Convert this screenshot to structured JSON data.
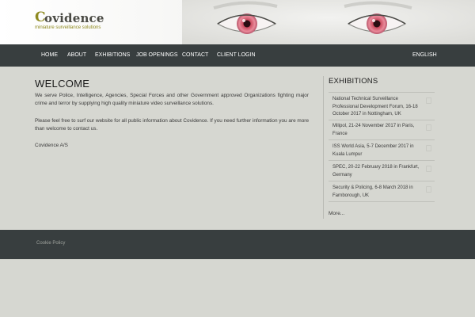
{
  "header": {
    "logo_initial": "C",
    "logo_rest": "ovidence",
    "tagline": "miniature surveillance solutions"
  },
  "nav": {
    "home": "HOME",
    "about": "ABOUT",
    "exhibitions": "EXHIBITIONS",
    "job_openings": "JOB OPENINGS",
    "contact": "CONTACT",
    "client_login": "CLIENT LOGIN",
    "language": "ENGLISH"
  },
  "main": {
    "title": "WELCOME",
    "paragraph1": "We serve Police, Intelligence, Agencies, Special Forces and other Government approved Organizations fighting major crime and terror by supplying high quality miniature video surveillance solutions.",
    "paragraph2": "Please feel free to surf our website for all public information about Covidence. If you need further information you are more than welcome to contact us.",
    "signature": "Covidence A/S"
  },
  "sidebar": {
    "title": "EXHIBITIONS",
    "items": [
      "National Technical Surveillance Professional Development Forum, 16-18 October 2017 in Nottingham, UK",
      "Milipol, 21-24 November 2017 in Paris, France",
      "ISS World Asia, 5-7 December 2017 in Kuala Lumpur",
      "SPEC, 20-22 February 2018 in Frankfurt, Germany",
      "Security & Policing, 6-8 March 2018 in Farnborough, UK"
    ],
    "more": "More..."
  },
  "footer": {
    "cookie_policy": "Cookie Policy"
  },
  "colors": {
    "accent": "#8e8a1f",
    "nav_bg": "#383e3f",
    "page_bg": "#d6d7d1",
    "iris": "#d86a7e"
  },
  "icons": [
    "eyes-image",
    "exhibition-item-icon"
  ]
}
